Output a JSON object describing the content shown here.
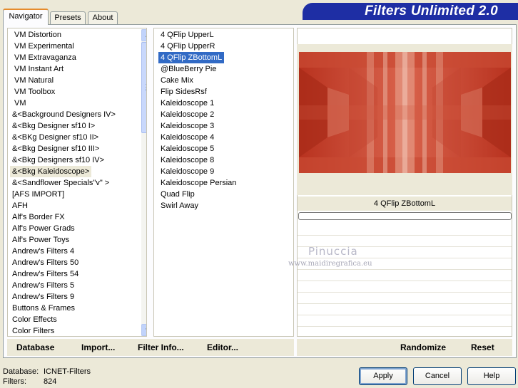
{
  "tabs": [
    "Navigator",
    "Presets",
    "About"
  ],
  "app_title": "Filters Unlimited 2.0",
  "categories": [
    "VM Distortion",
    "VM Experimental",
    "VM Extravaganza",
    "VM Instant Art",
    "VM Natural",
    "VM Toolbox",
    "VM",
    "&<Background Designers IV>",
    "&<Bkg Designer sf10 I>",
    "&<BKg Designer sf10 II>",
    "&<Bkg Designer sf10 III>",
    "&<Bkg Designers sf10 IV>",
    "&<Bkg Kaleidoscope>",
    "&<Sandflower Specials\"v\" >",
    "[AFS IMPORT]",
    "AFH",
    "Alf's Border FX",
    "Alf's Power Grads",
    "Alf's Power Toys",
    "Andrew's Filters 4",
    "Andrew's Filters 50",
    "Andrew's Filters 54",
    "Andrew's Filters 5",
    "Andrew's Filters 9",
    "Buttons & Frames",
    "Color Effects",
    "Color Filters"
  ],
  "selected_category": "&<Bkg Kaleidoscope>",
  "filters": [
    "4 QFlip UpperL",
    "4 QFlip UpperR",
    "4 QFlip ZBottomL",
    "@BlueBerry Pie",
    "Cake Mix",
    "Flip SidesRsf",
    "Kaleidoscope 1",
    "Kaleidoscope 2",
    "Kaleidoscope 3",
    "Kaleidoscope 4",
    "Kaleidoscope 5",
    "Kaleidoscope 8",
    "Kaleidoscope 9",
    "Kaleidoscope Persian",
    "Quad Flip",
    "Swirl Away"
  ],
  "selected_filter": "4 QFlip ZBottomL",
  "current_filter_label": "4 QFlip ZBottomL",
  "watermark": {
    "name": "Pinuccia",
    "url": "www.maidiregrafica.eu"
  },
  "toolbar": {
    "database": "Database",
    "import": "Import...",
    "filter_info": "Filter Info...",
    "editor": "Editor...",
    "randomize": "Randomize",
    "reset": "Reset"
  },
  "status": {
    "database_label": "Database:",
    "database_value": "ICNET-Filters",
    "filters_label": "Filters:",
    "filters_value": "824"
  },
  "buttons": {
    "apply": "Apply",
    "cancel": "Cancel",
    "help": "Help"
  },
  "colors": {
    "title_banner": "#1e2ea4",
    "selection": "#316ac5",
    "preview_base": "#c0392b"
  },
  "icons": {
    "scroll_up": "triangle-up-icon",
    "scroll_down": "triangle-down-icon"
  }
}
